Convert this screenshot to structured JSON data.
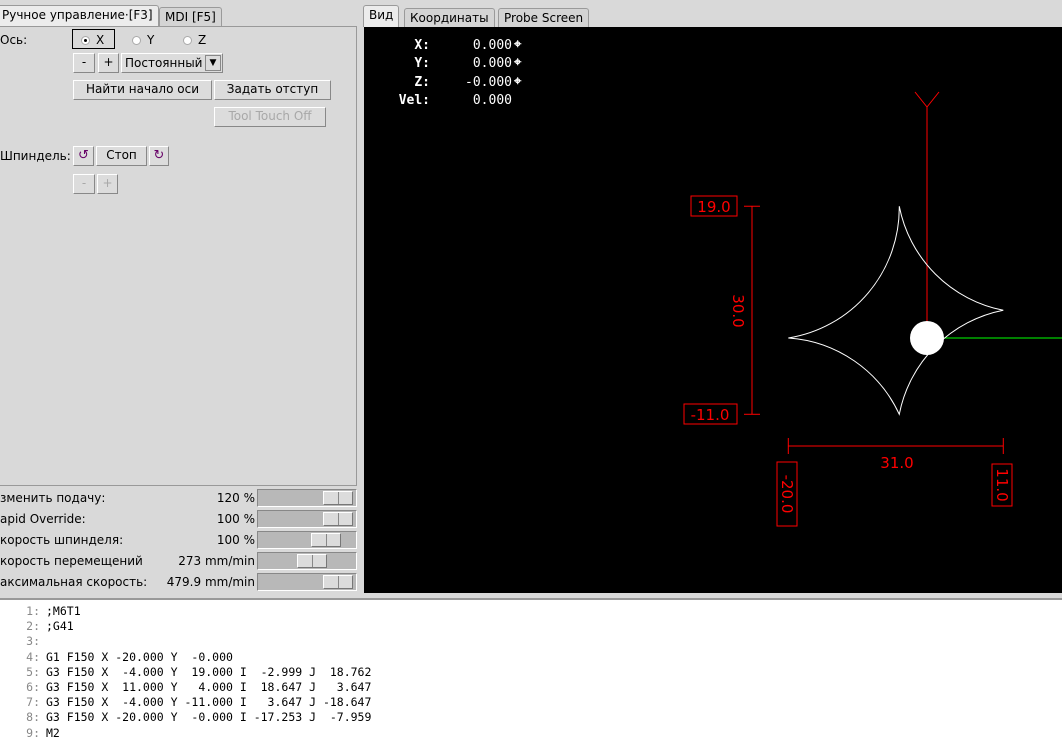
{
  "left_tabs": [
    {
      "label": "Ручное управление·[F3]",
      "active": true
    },
    {
      "label": "MDI [F5]",
      "active": false
    }
  ],
  "manual": {
    "axis_label": "Ось:",
    "axes": [
      {
        "label": "X",
        "selected": true
      },
      {
        "label": "Y",
        "selected": false
      },
      {
        "label": "Z",
        "selected": false
      }
    ],
    "jog_minus": "-",
    "jog_plus": "+",
    "jog_mode": "Постоянный",
    "home_button": "Найти начало оси",
    "touch_off_button": "Задать отступ",
    "tool_touch_off_button": "Tool Touch Off",
    "spindle_label": "Шпиндель:",
    "spindle_stop": "Стоп",
    "spindle_minus": "-",
    "spindle_plus": "+"
  },
  "sliders": [
    {
      "label": "зменить подачу:",
      "value": "120 %",
      "fraction": 0.95
    },
    {
      "label": "apid Override:",
      "value": "100 %",
      "fraction": 0.95
    },
    {
      "label": "корость шпинделя:",
      "value": "100 %",
      "fraction": 0.78
    },
    {
      "label": "корость перемещений",
      "value": "273 mm/min",
      "fraction": 0.57
    },
    {
      "label": "аксимальная скорость:",
      "value": "479.9 mm/min",
      "fraction": 0.95
    }
  ],
  "right_tabs": [
    {
      "label": "Вид",
      "active": true
    },
    {
      "label": "Координаты",
      "active": false
    },
    {
      "label": "Probe Screen",
      "active": false
    }
  ],
  "dro": [
    {
      "axis": "X:",
      "value": "0.000"
    },
    {
      "axis": "Y:",
      "value": "0.000"
    },
    {
      "axis": "Z:",
      "value": "-0.000"
    },
    {
      "axis": "Vel:",
      "value": "0.000"
    }
  ],
  "preview": {
    "axis_label": "Y",
    "dim_ymax": "19.0",
    "dim_ymin": "-11.0",
    "dim_height": "30.0",
    "dim_width": "31.0",
    "dim_xmin": "-20.0",
    "dim_xmax": "11.0",
    "colors": {
      "toolpath": "#ffffff",
      "dimension": "#ff0000",
      "x_axis": "#00ff00",
      "y_axis": "#ff0000"
    }
  },
  "gcode": [
    {
      "n": "1:",
      "text": ";M6T1"
    },
    {
      "n": "2:",
      "text": ";G41"
    },
    {
      "n": "3:",
      "text": ""
    },
    {
      "n": "4:",
      "text": "G1 F150 X -20.000 Y  -0.000"
    },
    {
      "n": "5:",
      "text": "G3 F150 X  -4.000 Y  19.000 I  -2.999 J  18.762"
    },
    {
      "n": "6:",
      "text": "G3 F150 X  11.000 Y   4.000 I  18.647 J   3.647"
    },
    {
      "n": "7:",
      "text": "G3 F150 X  -4.000 Y -11.000 I   3.647 J -18.647"
    },
    {
      "n": "8:",
      "text": "G3 F150 X -20.000 Y  -0.000 I -17.253 J  -7.959"
    },
    {
      "n": "9:",
      "text": "M2"
    }
  ]
}
